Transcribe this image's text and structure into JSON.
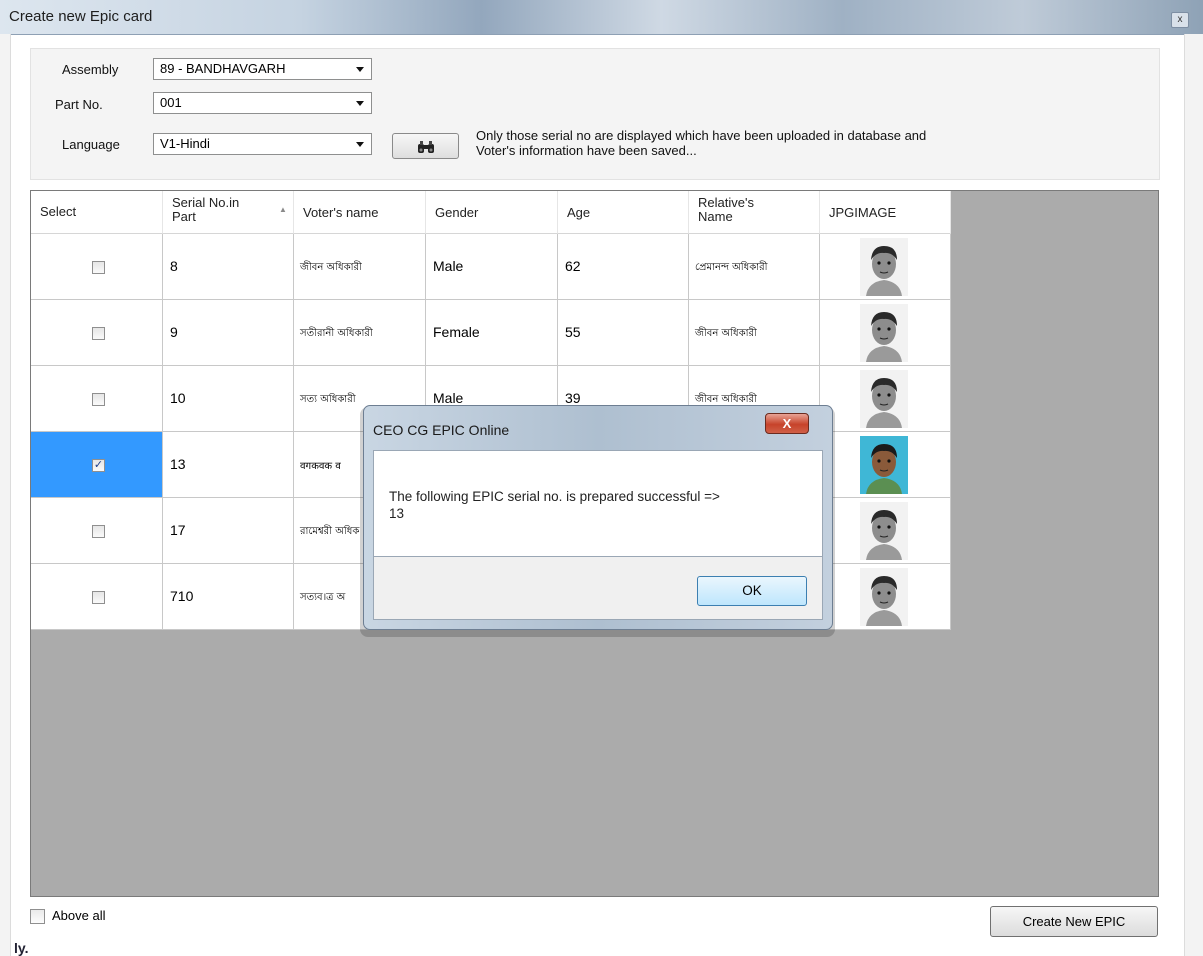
{
  "window": {
    "title": "Create new Epic card",
    "close_glyph": "x"
  },
  "filters": {
    "assembly_label": "Assembly",
    "assembly_value": "89 - BANDHAVGARH",
    "part_label": "Part No.",
    "part_value": "001",
    "language_label": "Language",
    "language_value": "V1-Hindi",
    "find_icon": "binoculars-icon",
    "info_line1": "Only those serial no are displayed which have been uploaded in database and",
    "info_line2": "Voter's information have been saved..."
  },
  "grid": {
    "headers": {
      "select": "Select",
      "serial_l1": "Serial No.in",
      "serial_l2": "Part",
      "sort_glyph": "▲",
      "voter": "Voter's name",
      "gender": "Gender",
      "age": "Age",
      "relative_l1": "Relative's",
      "relative_l2": "Name",
      "image": "JPGIMAGE"
    },
    "rows": [
      {
        "checked": false,
        "check_glyph": "",
        "serial": "8",
        "voter": "জীবন অধিকারী",
        "gender": "Male",
        "age": "62",
        "relative": "প্রেমানন্দ অধিকারী",
        "photo": "grayscale"
      },
      {
        "checked": false,
        "check_glyph": "",
        "serial": "9",
        "voter": "সতীরানী অধিকারী",
        "gender": "Female",
        "age": "55",
        "relative": "জীবন অধিকারী",
        "photo": "grayscale"
      },
      {
        "checked": false,
        "check_glyph": "",
        "serial": "10",
        "voter": "সত্য অধিকারী",
        "gender": "Male",
        "age": "39",
        "relative": "জীবন অধিকারী",
        "photo": "grayscale"
      },
      {
        "checked": true,
        "check_glyph": "✓",
        "serial": "13",
        "voter": "वगकवक व",
        "gender": "",
        "age": "",
        "relative": "",
        "photo": "color"
      },
      {
        "checked": false,
        "check_glyph": "",
        "serial": "17",
        "voter": "রামেশ্বরী অধিক",
        "gender": "",
        "age": "",
        "relative": "",
        "photo": "grayscale"
      },
      {
        "checked": false,
        "check_glyph": "",
        "serial": "710",
        "voter": "সত্যব।ত্র অ",
        "gender": "",
        "age": "",
        "relative": "",
        "photo": "grayscale"
      }
    ]
  },
  "footer": {
    "above_all_label": "Above all",
    "create_button": "Create New EPIC",
    "corner_text": "ly."
  },
  "dialog": {
    "title": "CEO CG EPIC Online",
    "close_glyph": "X",
    "message_line1": "The following EPIC serial no. is prepared successful =>",
    "message_line2": "13",
    "ok_label": "OK"
  },
  "colors": {
    "selected_row": "#3399ff",
    "grid_background": "#ababab",
    "dialog_close": "#c7432a"
  }
}
